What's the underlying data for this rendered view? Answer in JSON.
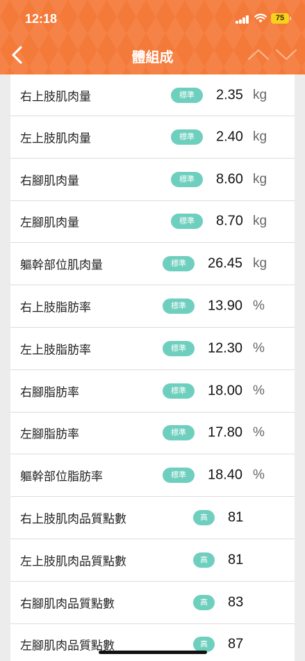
{
  "status_bar": {
    "time": "12:18",
    "battery": "75"
  },
  "header": {
    "title": "體組成"
  },
  "rows": [
    {
      "label": "右上肢肌肉量",
      "badge": "標準",
      "value": "2.35",
      "unit": "kg"
    },
    {
      "label": "左上肢肌肉量",
      "badge": "標準",
      "value": "2.40",
      "unit": "kg"
    },
    {
      "label": "右腳肌肉量",
      "badge": "標準",
      "value": "8.60",
      "unit": "kg"
    },
    {
      "label": "左腳肌肉量",
      "badge": "標準",
      "value": "8.70",
      "unit": "kg"
    },
    {
      "label": "軀幹部位肌肉量",
      "badge": "標準",
      "value": "26.45",
      "unit": "kg"
    },
    {
      "label": "右上肢脂肪率",
      "badge": "標準",
      "value": "13.90",
      "unit": "%"
    },
    {
      "label": "左上肢脂肪率",
      "badge": "標準",
      "value": "12.30",
      "unit": "%"
    },
    {
      "label": "右腳脂肪率",
      "badge": "標準",
      "value": "18.00",
      "unit": "%"
    },
    {
      "label": "左腳脂肪率",
      "badge": "標準",
      "value": "17.80",
      "unit": "%"
    },
    {
      "label": "軀幹部位脂肪率",
      "badge": "標準",
      "value": "18.40",
      "unit": "%"
    },
    {
      "label": "右上肢肌肉品質點數",
      "badge": "高",
      "value": "81",
      "unit": ""
    },
    {
      "label": "左上肢肌肉品質點數",
      "badge": "高",
      "value": "81",
      "unit": ""
    },
    {
      "label": "右腳肌肉品質點數",
      "badge": "高",
      "value": "83",
      "unit": ""
    },
    {
      "label": "左腳肌肉品質點數",
      "badge": "高",
      "value": "87",
      "unit": ""
    }
  ],
  "colors": {
    "header": "#f47a3a",
    "badge": "#6fcfbe",
    "battery": "#f7d21c"
  },
  "icons": {
    "back": "chevron-left-icon",
    "prev": "chevron-up-icon",
    "next": "chevron-down-icon"
  }
}
